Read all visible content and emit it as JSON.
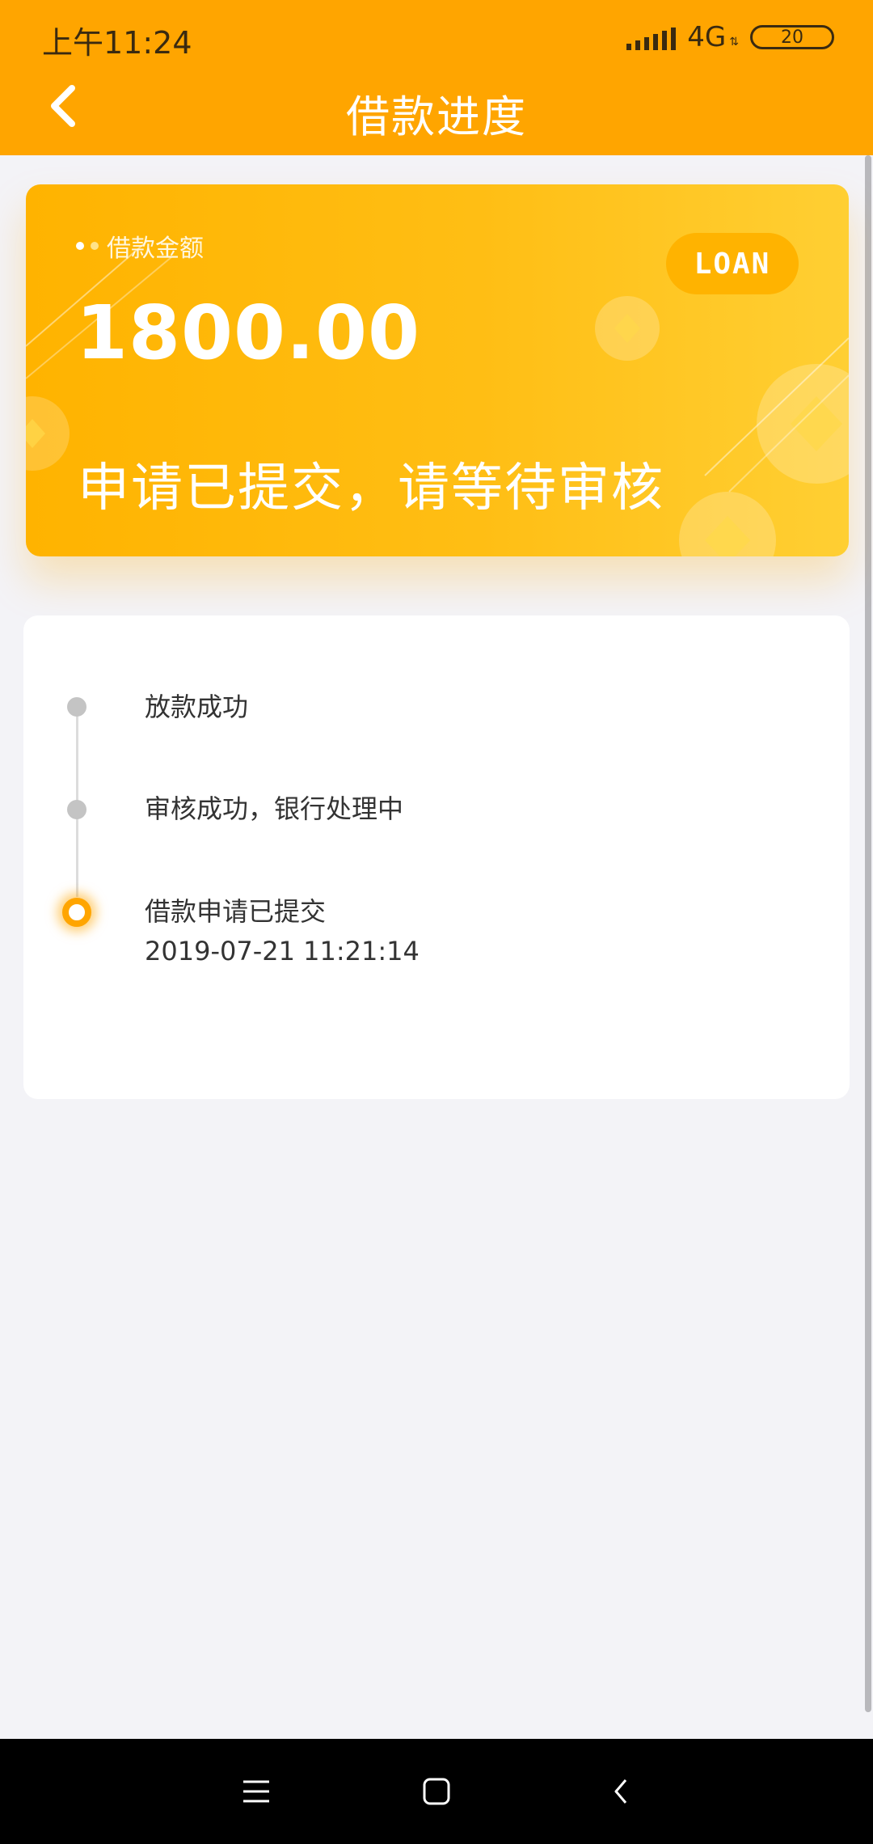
{
  "status_bar": {
    "time": "上午11:24",
    "network": "4G",
    "battery": "20"
  },
  "header": {
    "title": "借款进度"
  },
  "loan_card": {
    "amount_label": "借款金额",
    "amount": "1800.00",
    "status": "申请已提交，请等待审核",
    "badge": "LOAN"
  },
  "timeline": {
    "items": [
      {
        "label": "放款成功",
        "time": "",
        "active": false
      },
      {
        "label": "审核成功，银行处理中",
        "time": "",
        "active": false
      },
      {
        "label": "借款申请已提交",
        "time": "2019-07-21 11:21:14",
        "active": true
      }
    ]
  },
  "colors": {
    "primary": "#ffa500",
    "card_gradient_start": "#ffb300",
    "card_gradient_end": "#ffcf33",
    "background": "#f3f3f7",
    "inactive_dot": "#c4c4c4"
  },
  "icons": {
    "back": "chevron-left-icon",
    "nav_menu": "menu-icon",
    "nav_home": "home-square-icon",
    "nav_back": "back-arrow-icon"
  }
}
